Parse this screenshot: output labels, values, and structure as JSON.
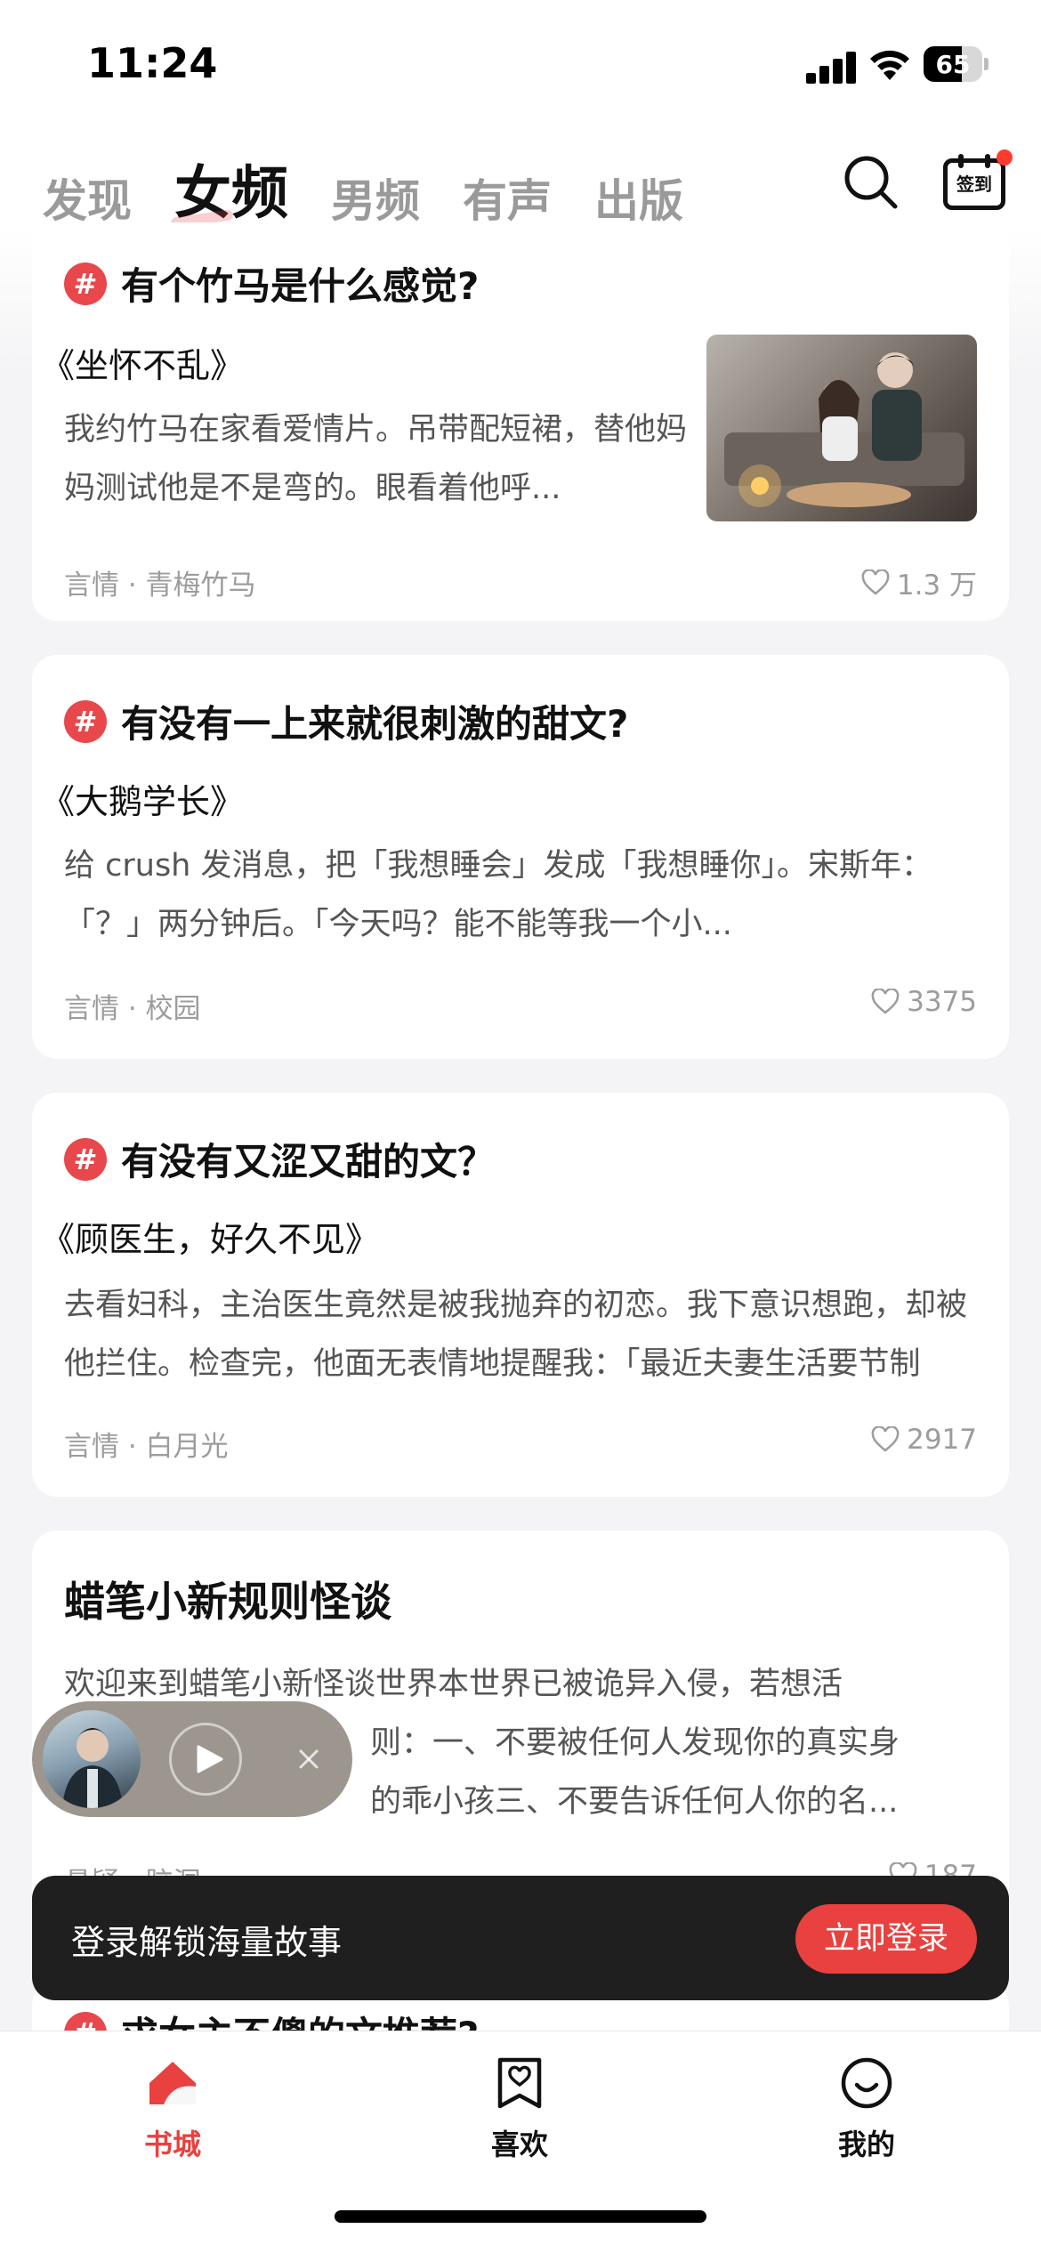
{
  "status_bar": {
    "time": "11:24",
    "battery": "65",
    "battery_level": 0.65
  },
  "tabs": [
    {
      "label": "发现",
      "active": false
    },
    {
      "label": "女频",
      "active": true
    },
    {
      "label": "男频",
      "active": false
    },
    {
      "label": "有声",
      "active": false
    },
    {
      "label": "出版",
      "active": false
    }
  ],
  "header": {
    "search_icon": "search-icon",
    "checkin_label": "签到",
    "accent_color": "#e8413f"
  },
  "cards": [
    {
      "topic": "有个竹马是什么感觉?",
      "book": "《坐怀不乱》",
      "excerpt": "我约竹马在家看爱情片。吊带配短裙，替他妈妈测试他是不是弯的。眼看着他呼...",
      "meta": "言情 · 青梅竹马",
      "likes": "1.3 万"
    },
    {
      "topic": "有没有一上来就很刺激的甜文?",
      "book": "《大鹅学长》",
      "excerpt": "给 crush 发消息，把「我想睡会」发成「我想睡你」。宋斯年：「？」两分钟后。「今天吗？能不能等我一个小...",
      "meta": "言情 · 校园",
      "likes": "3375"
    },
    {
      "topic": "有没有又涩又甜的文？",
      "book": "《顾医生，好久不见》",
      "excerpt": "去看妇科，主治医生竟然是被我抛弃的初恋。我下意识想跑，却被他拦住。检查完，他面无表情地提醒我：「最近夫妻生活要节制一...",
      "meta": "言情 · 白月光",
      "likes": "2917"
    },
    {
      "title": "蜡笔小新规则怪谈",
      "excerpt_line1": "欢迎来到蜡笔小新怪谈世界本世界已被诡异入侵，若想活",
      "excerpt_line2": "则：一、不要被任何人发现你的真实身",
      "excerpt_line3": "的乖小孩三、不要告诉任何人你的名...",
      "meta": "悬疑 · 脑洞",
      "likes": "187"
    },
    {
      "topic": "求女主不傻的文推荐?"
    }
  ],
  "login_banner": {
    "text": "登录解锁海量故事",
    "button": "立即登录"
  },
  "bottom_nav": [
    {
      "label": "书城",
      "icon": "home-icon",
      "active": true
    },
    {
      "label": "喜欢",
      "icon": "bookmark-heart-icon",
      "active": false
    },
    {
      "label": "我的",
      "icon": "smile-profile-icon",
      "active": false
    }
  ]
}
